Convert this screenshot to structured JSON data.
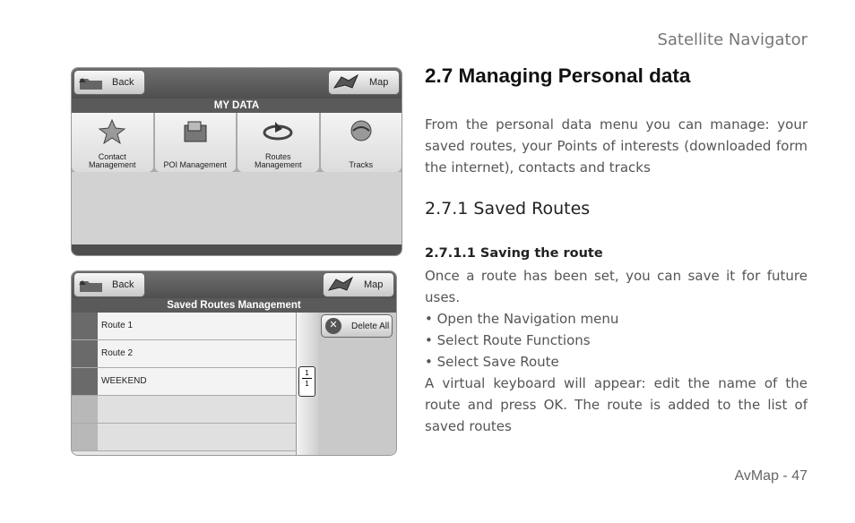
{
  "header": {
    "title": "Satellite Navigator"
  },
  "footer": {
    "page_label": "AvMap - 47"
  },
  "content": {
    "heading": "2.7 Managing Personal data",
    "intro": "From the personal data menu you can manage:  your saved routes, your Points of interests (downloaded form the internet), contacts and tracks",
    "subheading": "2.7.1 Saved Routes",
    "subsubheading": "2.7.1.1  Saving the route",
    "para_lines": [
      "Once a route has been set, you can save it for future uses.",
      "• Open the Navigation menu",
      "• Select Route Functions",
      "• Select Save Route",
      "A virtual keyboard will appear: edit the name of the route and press OK. The route is added to the list of saved routes"
    ]
  },
  "screen1": {
    "back_label": "Back",
    "map_label": "Map",
    "title": "MY DATA",
    "tiles": [
      {
        "label": "Contact\nManagement",
        "icon": "contact-icon"
      },
      {
        "label": "POI Management",
        "icon": "poi-icon"
      },
      {
        "label": "Routes\nManagement",
        "icon": "routes-icon"
      },
      {
        "label": "Tracks",
        "icon": "tracks-icon"
      }
    ]
  },
  "screen2": {
    "back_label": "Back",
    "map_label": "Map",
    "title": "Saved Routes Management",
    "routes": [
      "Route 1",
      "Route 2",
      "WEEKEND"
    ],
    "page_indicator": {
      "current": "1",
      "total": "1"
    },
    "delete_all_label": "Delete All"
  }
}
